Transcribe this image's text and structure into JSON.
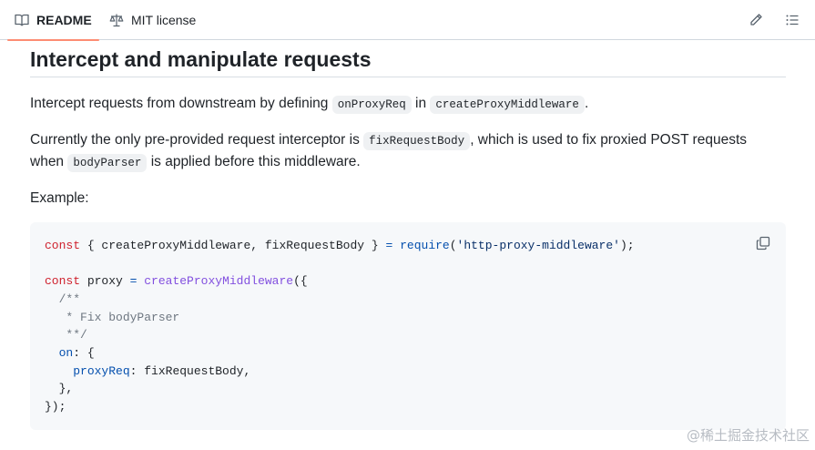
{
  "tabs": {
    "readme_label": "README",
    "license_label": "MIT license"
  },
  "heading": "Intercept and manipulate requests",
  "para1": {
    "t1": "Intercept requests from downstream by defining ",
    "c1": "onProxyReq",
    "t2": " in ",
    "c2": "createProxyMiddleware",
    "t3": "."
  },
  "para2": {
    "t1": "Currently the only pre-provided request interceptor is ",
    "c1": "fixRequestBody",
    "t2": ", which is used to fix proxied POST requests",
    "t3": "when ",
    "c2": "bodyParser",
    "t4": " is applied before this middleware."
  },
  "example_label": "Example:",
  "code": {
    "l1": {
      "kw": "const",
      "a": " { createProxyMiddleware, fixRequestBody } ",
      "op": "=",
      "b": " ",
      "fn": "require",
      "c": "(",
      "str": "'http-proxy-middleware'",
      "d": ");"
    },
    "l2": {
      "kw": "const",
      "a": " proxy ",
      "op": "=",
      "b": " ",
      "fn": "createProxyMiddleware",
      "c": "({"
    },
    "l3": "  /**",
    "l4": "   * Fix bodyParser",
    "l5": "   **/",
    "l6": {
      "indent": "  ",
      "prop": "on",
      "rest": ": {"
    },
    "l7": {
      "indent": "    ",
      "prop": "proxyReq",
      "rest": ": fixRequestBody,"
    },
    "l8": "  },",
    "l9": "});"
  },
  "watermark": "@稀土掘金技术社区"
}
